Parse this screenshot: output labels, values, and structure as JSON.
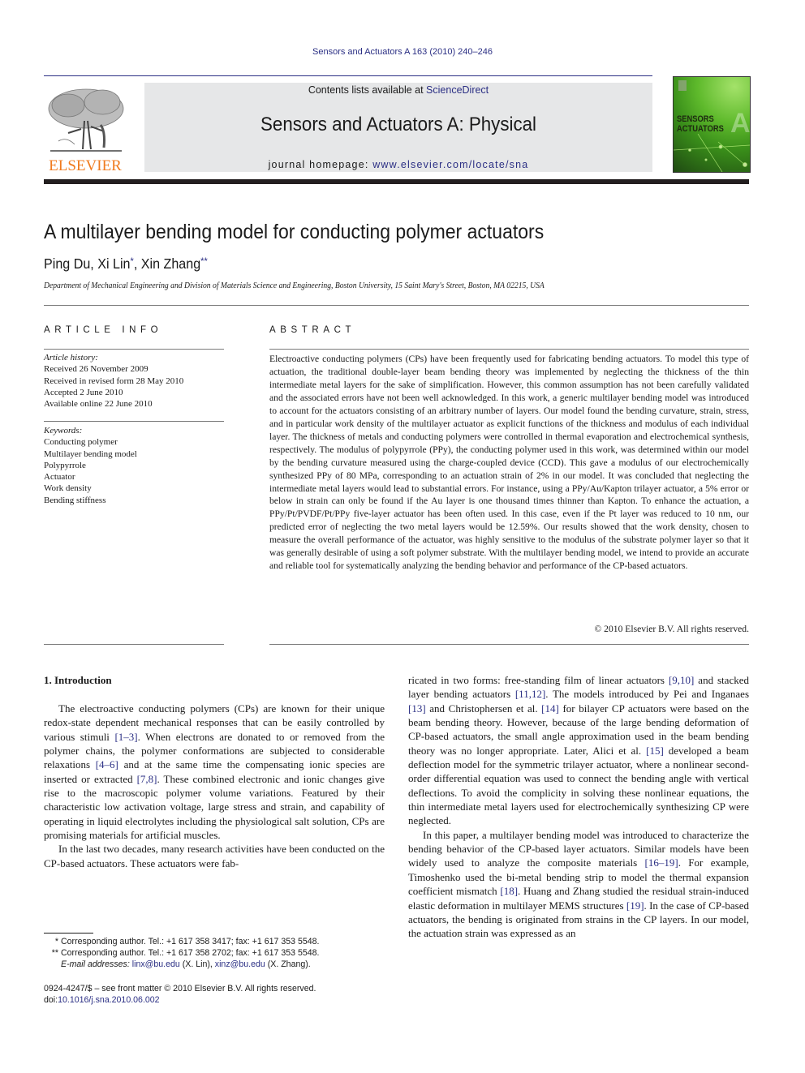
{
  "running_head": "Sensors and Actuators A 163 (2010) 240–246",
  "journal_header": {
    "publisher_logo_text": "ELSEVIER",
    "contents_prefix": "Contents lists available at ",
    "contents_link": "ScienceDirect",
    "journal_name": "Sensors and Actuators A: Physical",
    "homepage_prefix": "journal homepage: ",
    "homepage_link": "www.elsevier.com/locate/sna",
    "cover": {
      "line1": "SENSORS",
      "line2": "ACTUATORS",
      "letter": "A"
    }
  },
  "article": {
    "title": "A multilayer bending model for conducting polymer actuators",
    "authors": [
      {
        "name": "Ping Du",
        "mark": ""
      },
      {
        "name": "Xi Lin",
        "mark": "*"
      },
      {
        "name": "Xin Zhang",
        "mark": "**"
      }
    ],
    "separator": ", ",
    "affiliation": "Department of Mechanical Engineering and Division of Materials Science and Engineering, Boston University, 15 Saint Mary's Street, Boston, MA 02215, USA"
  },
  "article_info": {
    "heading": "ARTICLE INFO",
    "history_label": "Article history:",
    "history": [
      "Received 26 November 2009",
      "Received in revised form 28 May 2010",
      "Accepted 2 June 2010",
      "Available online 22 June 2010"
    ],
    "keywords_label": "Keywords:",
    "keywords": [
      "Conducting polymer",
      "Multilayer bending model",
      "Polypyrrole",
      "Actuator",
      "Work density",
      "Bending stiffness"
    ]
  },
  "abstract": {
    "heading": "ABSTRACT",
    "text": "Electroactive conducting polymers (CPs) have been frequently used for fabricating bending actuators. To model this type of actuation, the traditional double-layer beam bending theory was implemented by neglecting the thickness of the thin intermediate metal layers for the sake of simplification. However, this common assumption has not been carefully validated and the associated errors have not been well acknowledged. In this work, a generic multilayer bending model was introduced to account for the actu­ators consisting of an arbitrary number of layers. Our model found the bending curvature, strain, stress, and in particular work density of the multilayer actuator as explicit functions of the thickness and modu­lus of each individual layer. The thickness of metals and conducting polymers were controlled in thermal evaporation and electrochemical synthesis, respectively. The modulus of polypyrrole (PPy), the conduct­ing polymer used in this work, was determined within our model by the bending curvature measured using the charge-coupled device (CCD). This gave a modulus of our electrochemically synthesized PPy of 80 MPa, corresponding to an actuation strain of 2% in our model. It was concluded that neglecting the intermediate metal layers would lead to substantial errors. For instance, using a PPy/Au/Kapton trilayer actuator, a 5% error or below in strain can only be found if the Au layer is one thousand times thinner than Kapton. To enhance the actuation, a PPy/Pt/PVDF/Pt/PPy five-layer actuator has been often used. In this case, even if the Pt layer was reduced to 10 nm, our predicted error of neglecting the two metal layers would be 12.59%. Our results showed that the work density, chosen to measure the overall performance of the actuator, was highly sensitive to the modulus of the substrate polymer layer so that it was generally desirable of using a soft polymer substrate. With the multilayer bending model, we intend to provide an accurate and reliable tool for systematically analyzing the bending behavior and performance of the CP-based actuators.",
    "copyright": "© 2010 Elsevier B.V. All rights reserved."
  },
  "introduction": {
    "heading": "1.  Introduction",
    "left_column": [
      {
        "indent": true,
        "segments": [
          {
            "t": "The electroactive conducting polymers (CPs) are known for their unique redox-state dependent mechanical responses that can be easily controlled by various stimuli "
          },
          {
            "ref": "[1–3]"
          },
          {
            "t": ". When electrons are donated to or removed from the polymer chains, the polymer con­formations are subjected to considerable relaxations "
          },
          {
            "ref": "[4–6]"
          },
          {
            "t": " and at the same time the compensating ionic species are inserted or extracted "
          },
          {
            "ref": "[7,8]"
          },
          {
            "t": ". These combined electronic and ionic changes give rise to the macroscopic polymer volume variations. Featured by their characteristic low activation voltage, large stress and strain, and capability of operating in liquid electrolytes including the phys­iological salt solution, CPs are promising materials for artificial muscles."
          }
        ]
      },
      {
        "indent": true,
        "segments": [
          {
            "t": "In the last two decades, many research activities have been conducted on the CP-based actuators. These actuators were fab-"
          }
        ]
      }
    ],
    "right_column": [
      {
        "indent": false,
        "segments": [
          {
            "t": "ricated in two forms: free-standing film of linear actuators "
          },
          {
            "ref": "[9,10]"
          },
          {
            "t": " and stacked layer bending actuators "
          },
          {
            "ref": "[11,12]"
          },
          {
            "t": ". The models introduced by Pei and Inganaes "
          },
          {
            "ref": "[13]"
          },
          {
            "t": " and Christophersen et al. "
          },
          {
            "ref": "[14]"
          },
          {
            "t": " for bilayer CP actuators were based on the beam bending theory. However, because of the large bending deformation of CP-based actuators, the small angle approximation used in the beam bending theory was no longer appropriate. Later, Alici et al. "
          },
          {
            "ref": "[15]"
          },
          {
            "t": " developed a beam deflection model for the symmetric trilayer actuator, where a non­linear second-order differential equation was used to connect the bending angle with vertical deflections. To avoid the complicity in solving these nonlinear equations, the thin intermediate metal layers used for electrochemically synthesizing CP were neglected."
          }
        ]
      },
      {
        "indent": true,
        "segments": [
          {
            "t": "In this paper, a multilayer bending model was introduced to characterize the bending behavior of the CP-based layer actuators. Similar models have been widely used to analyze the compos­ite materials "
          },
          {
            "ref": "[16–19]"
          },
          {
            "t": ". For example, Timoshenko used the bi-metal bending strip to model the thermal expansion coefficient mismatch "
          },
          {
            "ref": "[18]"
          },
          {
            "t": ". Huang and Zhang studied the residual strain-induced elas­tic deformation in multilayer MEMS structures "
          },
          {
            "ref": "[19]"
          },
          {
            "t": ". In the case of CP-based actuators, the bending is originated from strains in the CP layers. In our model, the actuation strain was expressed as an"
          }
        ]
      }
    ]
  },
  "footnotes": {
    "items": [
      {
        "mark": "*",
        "text": "Corresponding author. Tel.: +1 617 358 3417; fax: +1 617 353 5548."
      },
      {
        "mark": "**",
        "text": "Corresponding author. Tel.: +1 617 358 2702; fax: +1 617 353 5548."
      }
    ],
    "email_label": "E-mail addresses:",
    "emails": [
      {
        "address": "linx@bu.edu",
        "who": " (X. Lin), "
      },
      {
        "address": "xinz@bu.edu",
        "who": " (X. Zhang)."
      }
    ],
    "front_matter": "0924-4247/$ – see front matter © 2010 Elsevier B.V. All rights reserved.",
    "doi_prefix": "doi:",
    "doi": "10.1016/j.sna.2010.06.002"
  }
}
